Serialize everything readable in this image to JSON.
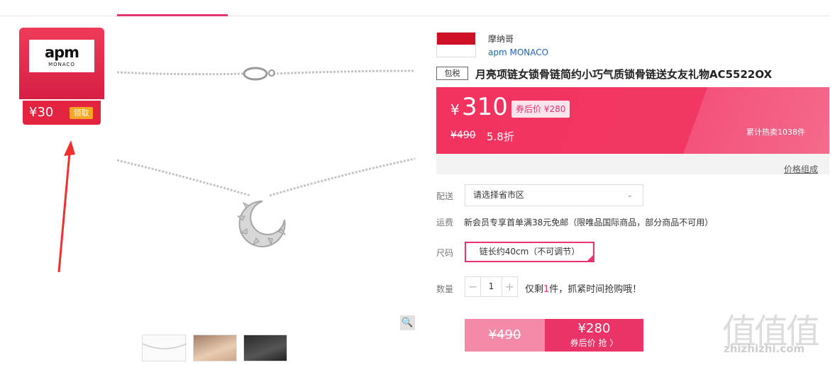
{
  "coupon": {
    "brand_main": "apm",
    "brand_sub": "MONACO",
    "amount": "¥30",
    "claim_label": "领取"
  },
  "brand": {
    "name_cn": "摩纳哥",
    "name_en": "apm MONACO"
  },
  "product": {
    "tax_tag": "包税",
    "title": "月亮项链女锁骨链简约小巧气质锁骨链送女友礼物AC5522OX"
  },
  "price": {
    "currency": "¥",
    "value": "310",
    "after_coupon": "券后价 ¥280",
    "original": "¥490",
    "discount": "5.8折",
    "sold": "累计热卖1038件",
    "compose_link": "价格组成"
  },
  "delivery": {
    "label": "配送",
    "select_value": "请选择省市区"
  },
  "shipping": {
    "label": "运费",
    "text": "新会员专享首单满38元免邮（限唯品国际商品，部分商品不可用）"
  },
  "size": {
    "label": "尺码",
    "option": "链长约40cm（不可调节）"
  },
  "quantity": {
    "label": "数量",
    "minus": "−",
    "value": "1",
    "plus": "+",
    "stock_prefix": "仅剩",
    "stock_count": "1",
    "stock_suffix": "件，抓紧时间抢购哦！"
  },
  "buy": {
    "original": "¥490",
    "price": "¥280",
    "label": "券后价 抢 〉"
  },
  "watermark": {
    "glyphs": "值值值",
    "site": "zhizhizhi.com"
  },
  "colors": {
    "accent": "#e8336d",
    "banner": "#f2325f",
    "coupon": "#e3233f"
  }
}
